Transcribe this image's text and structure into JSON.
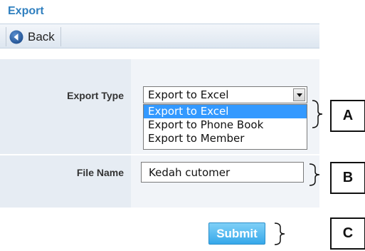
{
  "page": {
    "title": "Export"
  },
  "toolbar": {
    "back_label": "Back"
  },
  "form": {
    "export_type": {
      "label": "Export Type",
      "selected": "Export to Excel",
      "options": [
        "Export to Excel",
        "Export to Phone Book",
        "Export to Member"
      ]
    },
    "file_name": {
      "label": "File Name",
      "value": "Kedah cutomer"
    },
    "submit_label": "Submit"
  },
  "annotations": {
    "a": "A",
    "b": "B",
    "c": "C"
  },
  "icons": {
    "back": "back-arrow-circle-icon",
    "dropdown": "chevron-down-icon"
  },
  "colors": {
    "title": "#2f7fbf",
    "selection": "#3399ff",
    "submit": "#36a8ea"
  }
}
